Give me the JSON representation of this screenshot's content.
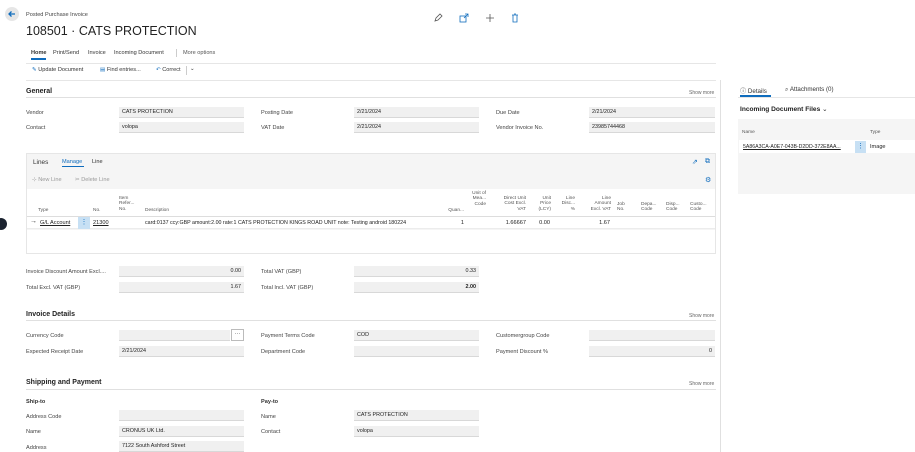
{
  "app": {
    "page_type": "Posted Purchase Invoice",
    "title": "108501 · CATS PROTECTION"
  },
  "top_icons": [
    "edit-icon",
    "share-icon",
    "add-icon",
    "delete-icon"
  ],
  "action_tabs": {
    "home": "Home",
    "print_send": "Print/Send",
    "invoice": "Invoice",
    "incoming_document": "Incoming Document",
    "more": "More options"
  },
  "toolbar": {
    "update_document": "Update Document",
    "find_entries": "Find entries...",
    "correct": "Correct"
  },
  "general": {
    "title": "General",
    "show_more": "Show more",
    "vendor_label": "Vendor",
    "vendor_value": "CATS PROTECTION",
    "contact_label": "Contact",
    "contact_value": "volopa",
    "posting_date_label": "Posting Date",
    "posting_date_value": "2/21/2024",
    "vat_date_label": "VAT Date",
    "vat_date_value": "2/21/2024",
    "due_date_label": "Due Date",
    "due_date_value": "2/21/2024",
    "vendor_invoice_label": "Vendor Invoice No.",
    "vendor_invoice_value": "23985744468"
  },
  "lines": {
    "tab_lines": "Lines",
    "tab_manage": "Manage",
    "tab_line": "Line",
    "new_line": "New Line",
    "delete_line": "Delete Line",
    "columns": {
      "type": "Type",
      "no": "No.",
      "item_ref": "Item Refer... No.",
      "description": "Description",
      "quantity": "Quan...",
      "uom": "Unit of Mea... Code",
      "direct_unit_cost": "Direct Unit Cost Excl. VAT",
      "unit_price": "Unit Price (LCY)",
      "line_disc": "Line Disc... %",
      "line_amount": "Line Amount Excl. VAT",
      "job_no": "Job No.",
      "dept_code": "Depa... Code",
      "disp_code": "Disp... Code",
      "cust_code": "Custo... Code"
    },
    "rows": [
      {
        "type": "G/L Account",
        "no": "21300",
        "description": "card:0137 ccy:GBP amount:2.00 rate:1 CATS PROTECTION KINGS ROAD UNIT note: Testing android 180224",
        "quantity": "1",
        "direct_unit_cost": "1.66667",
        "unit_price": "0.00",
        "line_amount": "1.67"
      }
    ]
  },
  "totals": {
    "invoice_discount_label": "Invoice Discount Amount Excl....",
    "invoice_discount_value": "0.00",
    "total_excl_vat_label": "Total Excl. VAT (GBP)",
    "total_excl_vat_value": "1.67",
    "total_vat_label": "Total VAT (GBP)",
    "total_vat_value": "0.33",
    "total_incl_vat_label": "Total Incl. VAT (GBP)",
    "total_incl_vat_value": "2.00"
  },
  "invoice_details": {
    "title": "Invoice Details",
    "show_more": "Show more",
    "currency_code_label": "Currency Code",
    "currency_code_value": "",
    "expected_receipt_label": "Expected Receipt Date",
    "expected_receipt_value": "2/21/2024",
    "payment_terms_label": "Payment Terms Code",
    "payment_terms_value": "COD",
    "department_code_label": "Department Code",
    "department_code_value": "",
    "customergroup_label": "Customergroup Code",
    "customergroup_value": "",
    "payment_discount_label": "Payment Discount %",
    "payment_discount_value": "0"
  },
  "shipping": {
    "title": "Shipping and Payment",
    "show_more": "Show more",
    "ship_to_label": "Ship-to",
    "address_code_label": "Address Code",
    "address_code_value": "",
    "name_label": "Name",
    "name_value": "CRONUS UK Ltd.",
    "address_label": "Address",
    "address_value": "7122 South Ashford Street",
    "pay_to_label": "Pay-to",
    "pay_name_label": "Name",
    "pay_name_value": "CATS PROTECTION",
    "pay_contact_label": "Contact",
    "pay_contact_value": "volopa"
  },
  "factbox": {
    "tab_details": "Details",
    "tab_attachments": "Attachments (0)",
    "incoming_title": "Incoming Document Files",
    "col_name": "Name",
    "col_type": "Type",
    "file_name": "5A86A3CA-A0E7-043B-D2DD-372E8AA...",
    "file_type": "Image"
  },
  "colors": {
    "accent": "#0f6cbd",
    "field_bg": "#f0f0f0",
    "panel_bg": "#f5f5f5"
  }
}
